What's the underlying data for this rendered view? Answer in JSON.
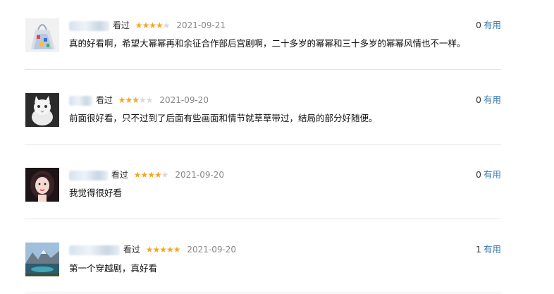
{
  "reviews": [
    {
      "watched_label": "看过",
      "rating": 4,
      "stars": [
        {
          "filled": true
        },
        {
          "filled": true
        },
        {
          "filled": true
        },
        {
          "filled": true
        },
        {
          "filled": false
        }
      ],
      "date": "2021-09-21",
      "text": "真的好看啊，希望大幂幂再和余征合作部后宫剧啊，二十多岁的幂幂和三十多岁的幂幂风情也不一样。",
      "useful_count": "0",
      "useful_label": "有用"
    },
    {
      "watched_label": "看过",
      "rating": 3,
      "stars": [
        {
          "filled": true
        },
        {
          "filled": true
        },
        {
          "filled": true
        },
        {
          "filled": false
        },
        {
          "filled": false
        }
      ],
      "date": "2021-09-20",
      "text": "前面很好看，只不过到了后面有些画面和情节就草草带过，结局的部分好随便。",
      "useful_count": "0",
      "useful_label": "有用"
    },
    {
      "watched_label": "看过",
      "rating": 4,
      "stars": [
        {
          "filled": true
        },
        {
          "filled": true
        },
        {
          "filled": true
        },
        {
          "filled": true
        },
        {
          "filled": false
        }
      ],
      "date": "2021-09-20",
      "text": "我觉得很好看",
      "useful_count": "0",
      "useful_label": "有用"
    },
    {
      "watched_label": "看过",
      "rating": 5,
      "stars": [
        {
          "filled": true
        },
        {
          "filled": true
        },
        {
          "filled": true
        },
        {
          "filled": true
        },
        {
          "filled": true
        }
      ],
      "date": "2021-09-20",
      "text": "第一个穿越剧，真好看",
      "useful_count": "1",
      "useful_label": "有用"
    }
  ],
  "colors": {
    "star_on": "#f5a623",
    "star_off": "#d9d9d9",
    "link": "#3377aa",
    "divider": "#e5e5e5",
    "date": "#888888"
  }
}
